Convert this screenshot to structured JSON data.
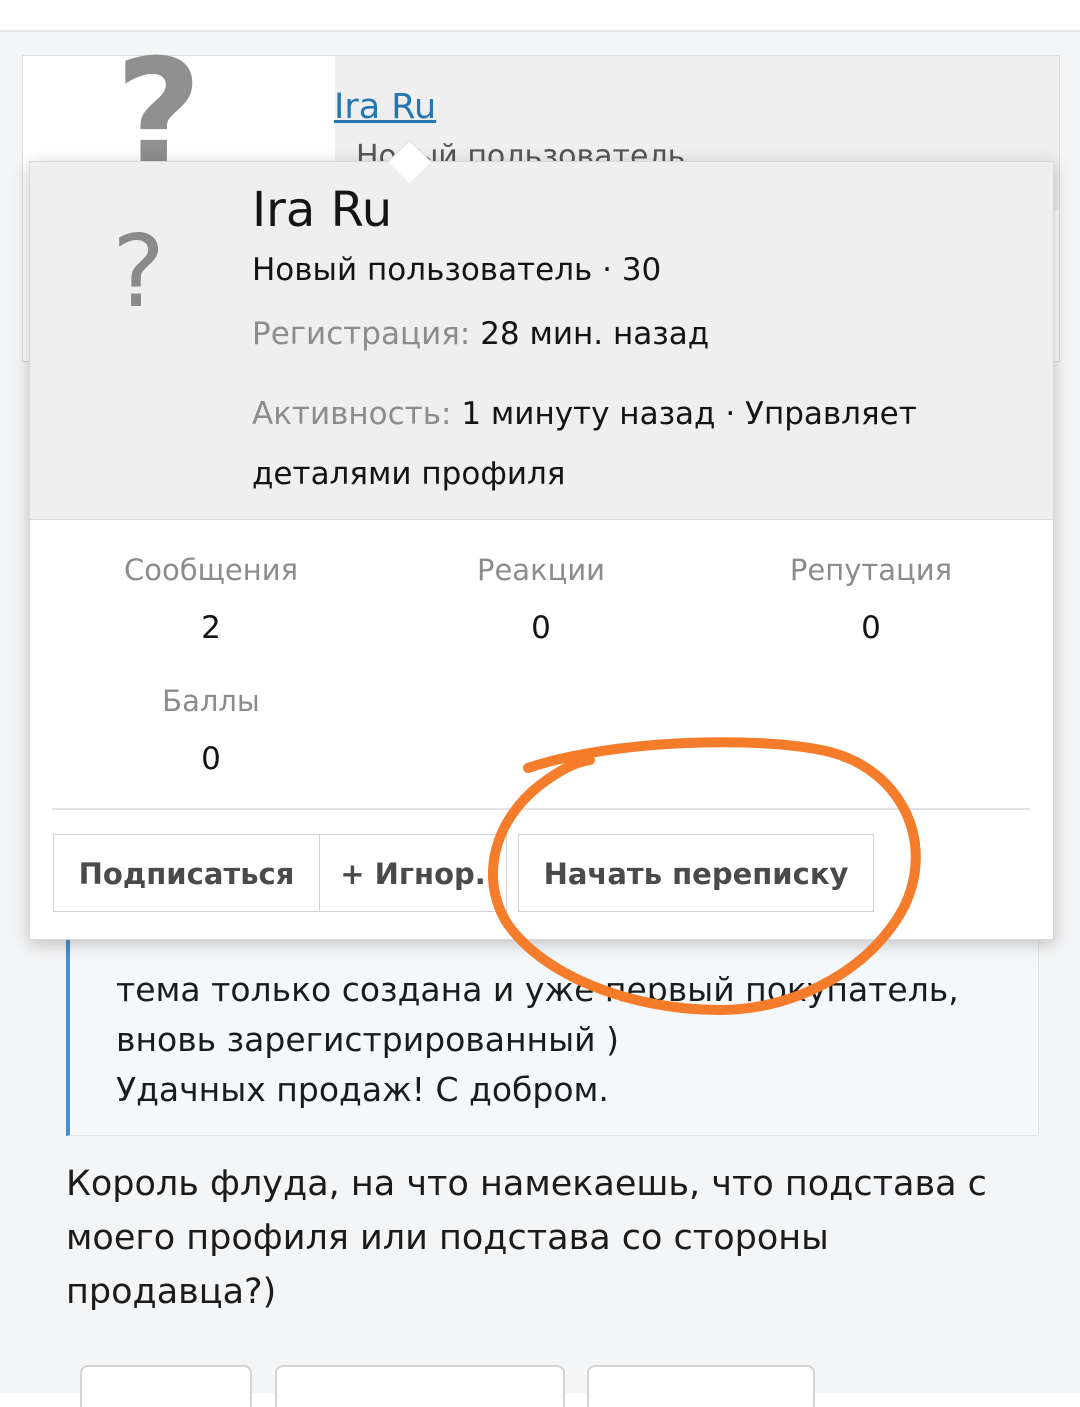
{
  "post": {
    "username": "Ira Ru",
    "usertitle": "Новый пользователь",
    "avatar_glyph": "?"
  },
  "tooltip": {
    "avatar_glyph": "?",
    "name": "Ira Ru",
    "title": "Новый пользователь · 30",
    "registration_label": "Регистрация:",
    "registration_value": "28 мин. назад",
    "activity_label": "Активность:",
    "activity_value": "1 минуту назад · Управляет деталями профиля",
    "stats": [
      {
        "label": "Сообщения",
        "value": "2"
      },
      {
        "label": "Реакции",
        "value": "0"
      },
      {
        "label": "Репутация",
        "value": "0"
      },
      {
        "label": "Баллы",
        "value": "0"
      }
    ],
    "buttons": {
      "follow": "Подписаться",
      "ignore": "+ Игнор.",
      "message": "Начать переписку"
    }
  },
  "quote": {
    "lines": [
      "тема только создана и уже первый покупатель,",
      "вновь зарегистрированный )",
      "Удачных продаж! С добром."
    ]
  },
  "post_text": "Король флуда, на что намекаешь, что подстава с моего профиля или подстава со стороны продавца?)",
  "colors": {
    "link": "#2577b1",
    "quote_border": "#4a90c8",
    "annotation": "#f47c2a"
  }
}
